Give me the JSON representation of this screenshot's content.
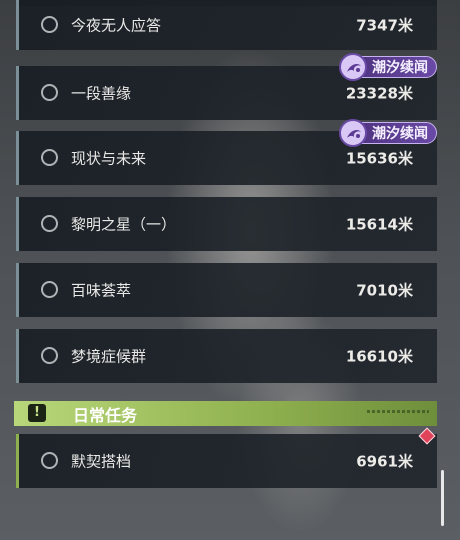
{
  "quests": [
    {
      "name": "今夜无人应答",
      "distance": "7347米"
    },
    {
      "name": "一段善缘",
      "distance": "23328米",
      "badge": "潮汐续闻"
    },
    {
      "name": "现状与未来",
      "distance": "15636米",
      "badge": "潮汐续闻"
    },
    {
      "name": "黎明之星（一）",
      "distance": "15614米"
    },
    {
      "name": "百味荟萃",
      "distance": "7010米"
    },
    {
      "name": "梦境症候群",
      "distance": "16610米"
    }
  ],
  "daily_section": {
    "icon_glyph": "!",
    "title": "日常任务"
  },
  "daily_quests": [
    {
      "name": "默契搭档",
      "distance": "6961米"
    }
  ],
  "icons": {
    "radio": "radio-circle-icon",
    "badge": "tidal-swirl-icon",
    "section": "exclamation-box-icon",
    "marker": "red-diamond-icon"
  },
  "colors": {
    "accent_green": "#b8d77a",
    "badge_purple": "#6a4aa6",
    "marker_red": "#e0445a"
  }
}
